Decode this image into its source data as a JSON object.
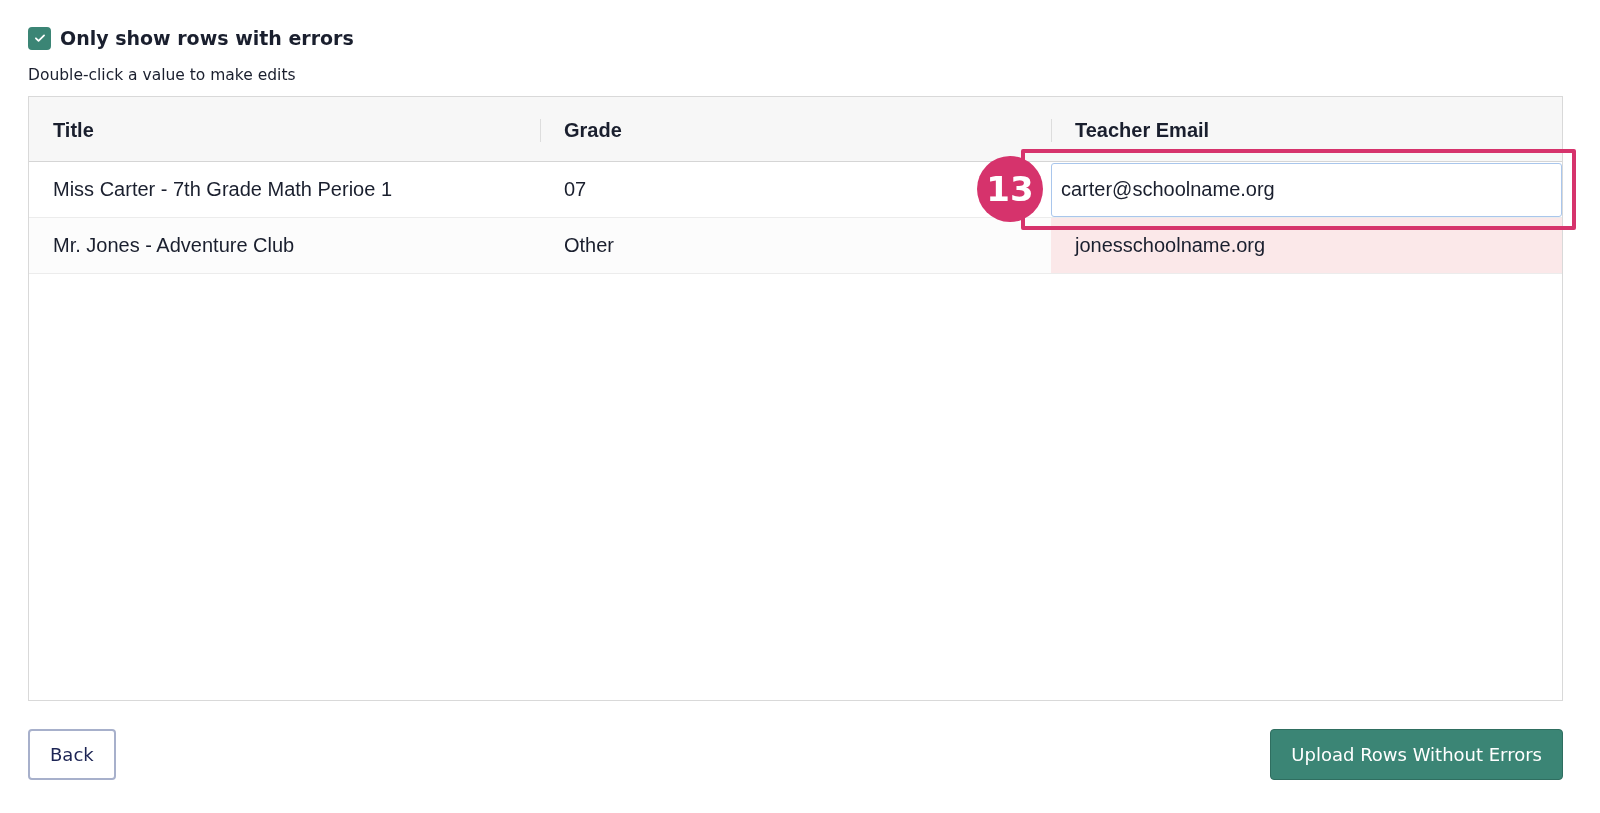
{
  "filter": {
    "label": "Only show rows with errors",
    "checked": true
  },
  "hint": "Double-click a value to make edits",
  "table": {
    "columns": [
      "Title",
      "Grade",
      "Teacher Email"
    ],
    "rows": [
      {
        "title": "Miss Carter - 7th Grade Math Perioe 1",
        "grade": "07",
        "email": {
          "text": "carter@schoolname.org",
          "editing": true,
          "error": false
        }
      },
      {
        "title": "Mr. Jones - Adventure Club",
        "grade": "Other",
        "email": {
          "text": "jonesschoolname.org",
          "editing": false,
          "error": true
        }
      }
    ]
  },
  "annotation": {
    "label": "13"
  },
  "buttons": [
    {
      "label": "Back",
      "kind": "secondary"
    },
    {
      "label": "Upload Rows Without Errors",
      "kind": "primary"
    }
  ]
}
